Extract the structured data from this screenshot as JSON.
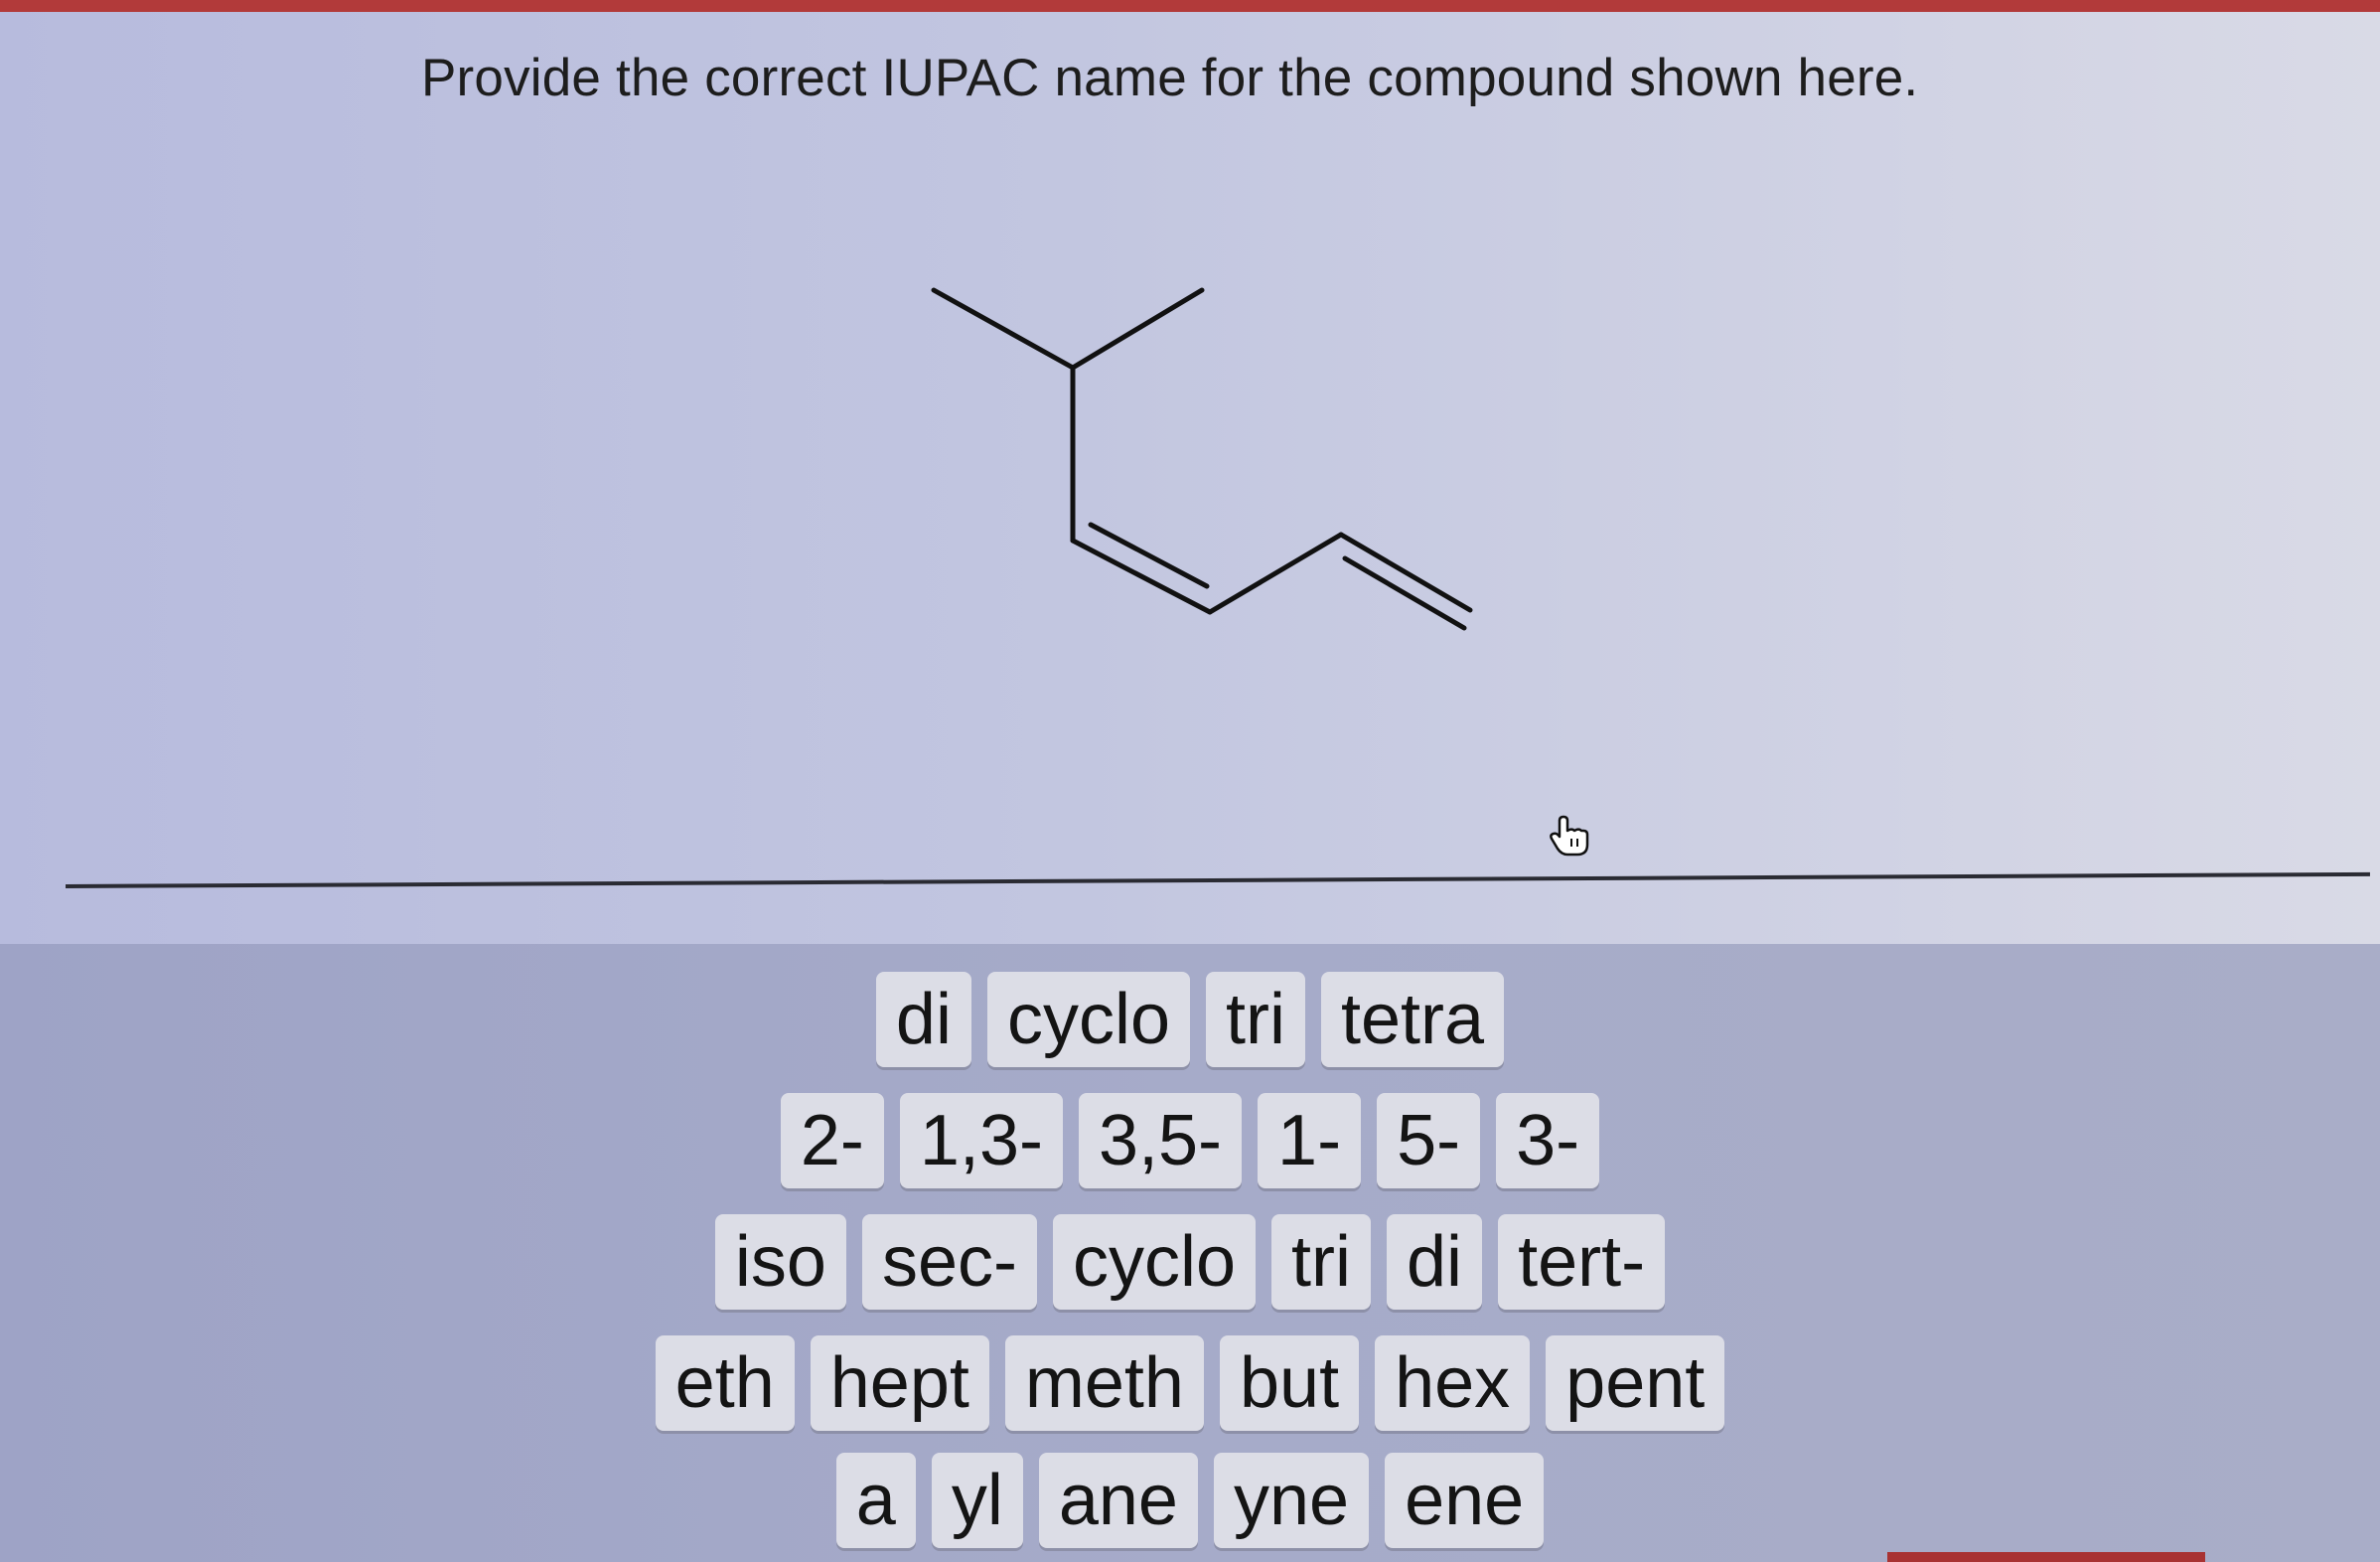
{
  "question": {
    "prompt": "Provide the correct IUPAC name for the compound shown here."
  },
  "answer_bank": {
    "row1": [
      "di",
      "cyclo",
      "tri",
      "tetra"
    ],
    "row2": [
      "2-",
      "1,3-",
      "3,5-",
      "1-",
      "5-",
      "3-"
    ],
    "row3": [
      "iso",
      "sec-",
      "cyclo",
      "tri",
      "di",
      "tert-"
    ],
    "row4": [
      "eth",
      "hept",
      "meth",
      "but",
      "hex",
      "pent"
    ],
    "row5": [
      "a",
      "yl",
      "ane",
      "yne",
      "ene"
    ]
  },
  "icons": {
    "cursor": "hand-pointer-icon"
  },
  "colors": {
    "accent": "#b23a3a",
    "tile_bg": "#dcdde6",
    "tile_text": "#141414"
  }
}
